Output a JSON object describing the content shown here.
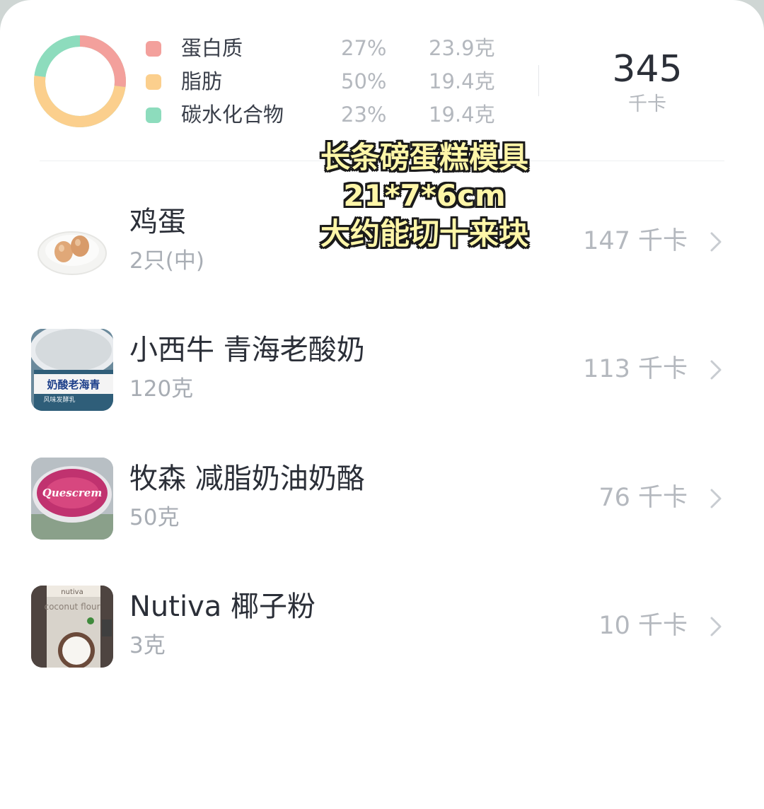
{
  "summary": {
    "macros": [
      {
        "name": "蛋白质",
        "percent": "27%",
        "amount": "23.9克",
        "color": "#f3a09c"
      },
      {
        "name": "脂肪",
        "percent": "50%",
        "amount": "19.4克",
        "color": "#fbcf8d"
      },
      {
        "name": "碳水化合物",
        "percent": "23%",
        "amount": "19.4克",
        "color": "#8ddcbd"
      }
    ],
    "donut_fractions": [
      0.27,
      0.5,
      0.23
    ],
    "total_kcal": "345",
    "kcal_unit": "千卡"
  },
  "overlay": {
    "lines": [
      "长条磅蛋糕模具",
      "21*7*6cm",
      "大约能切十来块"
    ]
  },
  "foods": [
    {
      "name": "鸡蛋",
      "portion": "2只(中)",
      "kcal": "147 千卡",
      "thumb_icon": "eggs-photo"
    },
    {
      "name": "小西牛 青海老酸奶",
      "portion": "120克",
      "kcal": "113 千卡",
      "thumb_icon": "yogurt-tub-photo",
      "thumb_text": "奶酸老海青",
      "thumb_subtext": "风味发酵乳"
    },
    {
      "name": "牧森 减脂奶油奶酪",
      "portion": "50克",
      "kcal": "76 千卡",
      "thumb_icon": "cream-cheese-tub-photo",
      "thumb_text": "Quescrem"
    },
    {
      "name": "Nutiva 椰子粉",
      "portion": "3克",
      "kcal": "10 千卡",
      "thumb_icon": "coconut-flour-bag-photo",
      "thumb_text": "coconut flour",
      "thumb_brand": "nutiva"
    }
  ]
}
